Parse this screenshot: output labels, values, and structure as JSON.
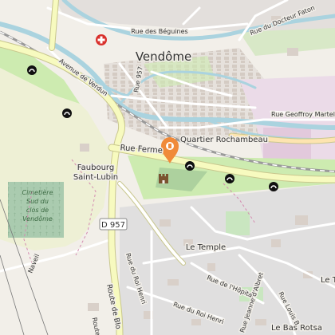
{
  "map": {
    "place_labels": {
      "city": "Vendôme",
      "quartier": "Quartier Rochambeau",
      "faubourg_1": "Faubourg",
      "faubourg_2": "Saint-Lubin",
      "cimetiere_1": "Cimetière",
      "cimetiere_2": "Sud du",
      "cimetiere_3": "clos de",
      "cimetiere_4": "Vendôme",
      "le_temple": "Le Temple",
      "le_bas_rotsa": "Le Bas Rotsa",
      "le_t": "Le T",
      "naveil": "Naveil"
    },
    "street_labels": {
      "rue_des_beguines": "Rue des Béguines",
      "rue_du_docteur_faton": "Rue du Docteur Faton",
      "avenue_de_verdun": "Avenue de Verdun",
      "rue_957": "Rue 957",
      "rue_geoffroy_martel": "Rue Geoffroy Martel",
      "rue_ferme": "Rue Ferme",
      "route_de_blois": "Route de Blo",
      "route_short": "Route",
      "rue_du_roi_henri_1": "Rue du Roi Henri",
      "rue_du_roi_henri_2": "Rue du Roi Henri",
      "rue_de_lhopital": "Rue de l'Hôpital",
      "rue_jeanne_dalbret": "Rue Jeanne d'Albret",
      "rue_louis_b": "Rue Louis B"
    },
    "road_shield": "D 957",
    "marker_note": "Le",
    "colors": {
      "background": "#f2efe9",
      "water": "#aad3df",
      "park": "#cdebb0",
      "cemetery": "#aacbaf",
      "main_road": "#f7fabf",
      "main_road_casing": "#c9c78e",
      "residential": "#e0dfdf",
      "buildings": "#d9d0c9",
      "marker": "#f08a3a",
      "hospital": "#d9302c",
      "railway": "#9a9a9a",
      "industrial": "#ebdbe8"
    }
  }
}
